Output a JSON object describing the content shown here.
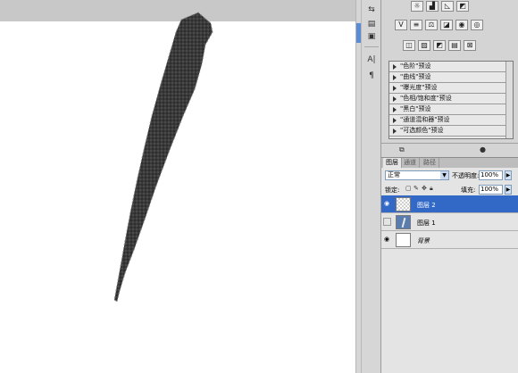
{
  "adjustments": {
    "row1_icons": [
      "brightness-icon",
      "levels-icon",
      "curves-icon",
      "exposure-icon"
    ],
    "row1_glyphs": [
      "☼",
      "▟",
      "◺",
      "◩"
    ],
    "row2_icons": [
      "vibrance-icon",
      "hue-saturation-icon",
      "color-balance-icon",
      "black-white-icon",
      "photo-filter-icon",
      "channel-mixer-icon"
    ],
    "row2_glyphs": [
      "V",
      "≡",
      "⚖",
      "◪",
      "◉",
      "◎"
    ],
    "row3_icons": [
      "invert-icon",
      "posterize-icon",
      "threshold-icon",
      "gradient-map-icon",
      "selective-color-icon"
    ],
    "row3_glyphs": [
      "◫",
      "▨",
      "◩",
      "▤",
      "⊠"
    ],
    "presets": [
      "\"色阶\"预设",
      "\"曲线\"预设",
      "\"曝光度\"预设",
      "\"色相/饱和度\"预设",
      "\"黑白\"预设",
      "\"通道混和器\"预设",
      "\"可选颜色\"预设"
    ]
  },
  "layers_panel": {
    "tabs": [
      "图层",
      "通道",
      "路径"
    ],
    "blend_mode": "正常",
    "opacity_label": "不透明度:",
    "opacity_value": "100%",
    "lock_label": "锁定:",
    "fill_label": "填充:",
    "fill_value": "100%",
    "layers": [
      {
        "name": "图层 2",
        "selected": true,
        "visible": true
      },
      {
        "name": "图层 1",
        "selected": false,
        "visible": false
      },
      {
        "name": "背景",
        "selected": false,
        "visible": true
      }
    ]
  },
  "colors": {
    "selection": "#3369c6",
    "stroke": "#3c3c3c",
    "canvas_top": "#c8c8c8"
  }
}
